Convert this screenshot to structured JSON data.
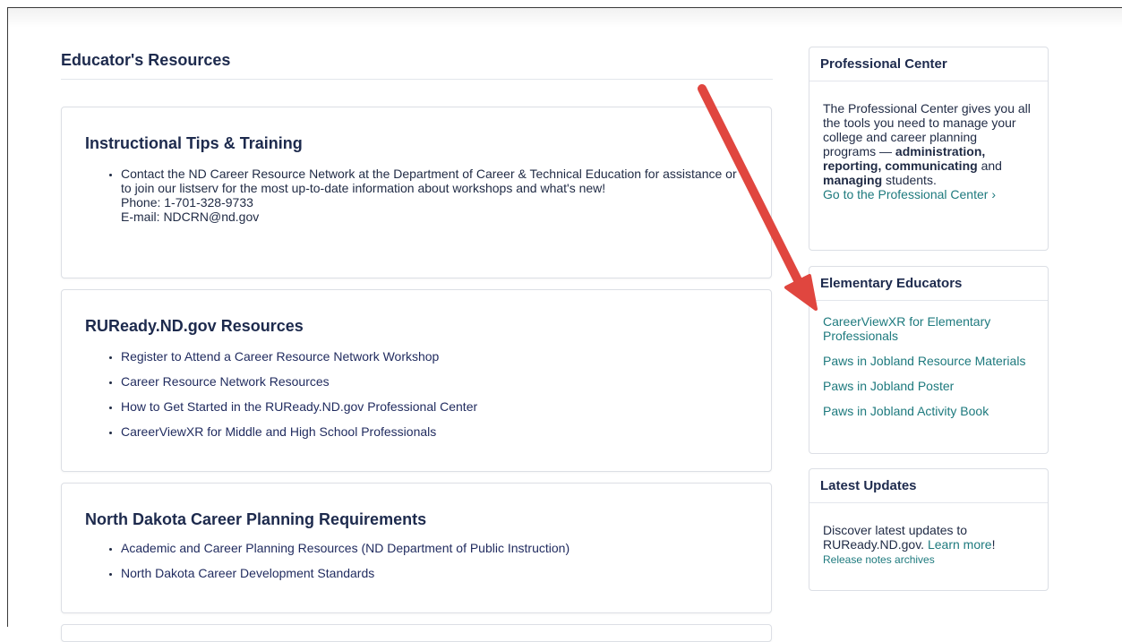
{
  "page": {
    "title": "Educator's Resources"
  },
  "cards": {
    "tips": {
      "title": "Instructional Tips & Training",
      "text": "Contact the ND Career Resource Network at the Department of Career & Technical Education for assistance or to join our listserv for the most up-to-date information about workshops and what's new!",
      "phone": "Phone: 1-701-328-9733",
      "email": "E-mail: NDCRN@nd.gov"
    },
    "resources": {
      "title": "RUReady.ND.gov Resources",
      "items": [
        "Register to Attend a Career Resource Network Workshop",
        "Career Resource Network Resources",
        "How to Get Started in the RUReady.ND.gov Professional Center",
        "CareerViewXR for Middle and High School Professionals"
      ]
    },
    "requirements": {
      "title": "North Dakota Career Planning Requirements",
      "items": [
        "Academic and Career Planning Resources (ND Department of Public Instruction)",
        "North Dakota Career Development Standards"
      ]
    }
  },
  "sidebar": {
    "professional": {
      "title": "Professional Center",
      "text1": "The Professional Center gives you all the tools you need to manage your college and career planning programs — ",
      "bold1": "administration, reporting, communicating",
      "text2": " and ",
      "bold2": "managing",
      "text3": " students.",
      "link": "Go to the Professional Center ›"
    },
    "elementary": {
      "title": "Elementary Educators",
      "links": [
        "CareerViewXR for Elementary Professionals",
        "Paws in Jobland Resource Materials",
        "Paws in Jobland Poster",
        "Paws in Jobland Activity Book"
      ]
    },
    "updates": {
      "title": "Latest Updates",
      "text": "Discover latest updates to RUReady.ND.gov.",
      "learn_more": "Learn more",
      "exclaim": "!",
      "release_notes": "Release notes archives"
    }
  },
  "annotation": {
    "arrow_color": "#e0463f"
  }
}
